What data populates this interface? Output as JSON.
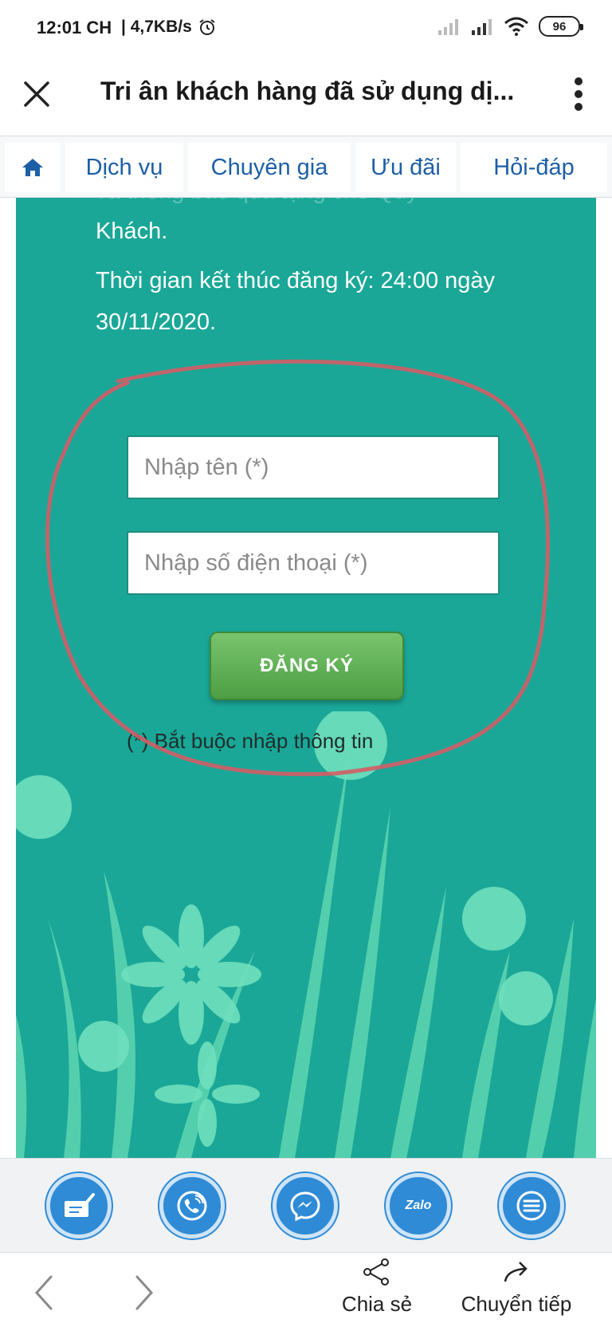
{
  "status_bar": {
    "time": "12:01 CH",
    "speed": "| 4,7KB/s",
    "battery": "96",
    "icons": [
      "alarm-icon",
      "signal-icon",
      "wifi-icon",
      "battery-icon"
    ]
  },
  "title_bar": {
    "title": "Tri ân khách hàng đã sử dụng dị...",
    "icons": [
      "close-icon",
      "more-vertical-icon"
    ]
  },
  "nav": {
    "home_icon": "home-icon",
    "items": [
      "Dịch vụ",
      "Chuyên gia",
      "Ưu đãi",
      "Hỏi-đáp"
    ]
  },
  "content": {
    "cut_text": "và thông báo quà tặng cho Quý",
    "p1": "Khách.",
    "p2": "Thời gian kết thúc đăng ký: 24:00 ngày 30/11/2020.",
    "background_color": "#1aa797"
  },
  "form": {
    "name_placeholder": "Nhập tên (*)",
    "phone_placeholder": "Nhập số điện thoại (*)",
    "submit_label": "ĐĂNG KÝ",
    "note": "(*) Bắt buộc nhập thông tin",
    "highlight_color": "#d9534f"
  },
  "action_bar": {
    "buttons": [
      "register-form-icon",
      "phone-call-icon",
      "messenger-icon",
      "zalo-icon",
      "menu-icon"
    ],
    "zalo_label": "Zalo",
    "accent": "#2f8bd6"
  },
  "browser_bar": {
    "share_label": "Chia sẻ",
    "forward_label": "Chuyển tiếp",
    "icons": [
      "back-arrow-icon",
      "forward-arrow-icon",
      "share-icon",
      "forward-share-icon"
    ]
  }
}
